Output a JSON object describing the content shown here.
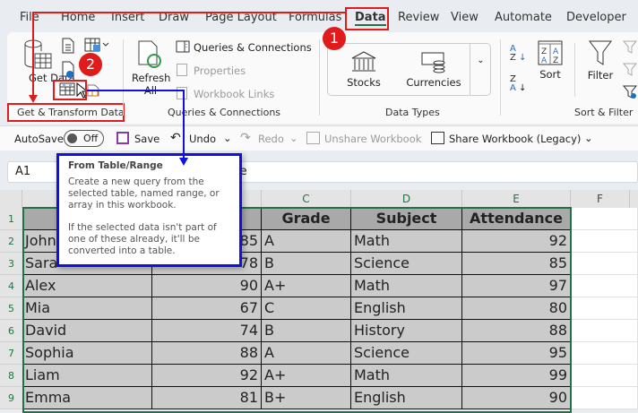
{
  "tabs": [
    "File",
    "Home",
    "Insert",
    "Draw",
    "Page Layout",
    "Formulas",
    "Data",
    "Review",
    "View",
    "Automate",
    "Developer"
  ],
  "active_tab": "Data",
  "ribbon": {
    "get_data": "Get Data",
    "groups": {
      "get_transform": "Get & Transform Data",
      "queries": "Queries & Connections",
      "data_types": "Data Types",
      "sort_filter": "Sort & Filter"
    },
    "refresh_all": "Refresh All",
    "queries_connections": "Queries & Connections",
    "properties": "Properties",
    "workbook_links": "Workbook Links",
    "stocks": "Stocks",
    "currencies": "Currencies",
    "sort": "Sort",
    "filter": "Filter"
  },
  "qat": {
    "autosave": "AutoSave",
    "autosave_state": "Off",
    "save": "Save",
    "undo": "Undo",
    "redo": "Redo",
    "unshare": "Unshare Workbook",
    "share": "Share Workbook (Legacy)"
  },
  "formula_bar": {
    "name_box": "A1",
    "content_visible": "ame"
  },
  "tooltip": {
    "title": "From Table/Range",
    "p1": "Create a new query from the selected table, named range, or array in this workbook.",
    "p2": "If the selected data isn't part of one of these already, it'll be converted into a table."
  },
  "annotations": {
    "step1": "1",
    "step2": "2",
    "color_red": "#e01b1b",
    "color_blue": "#1010e0"
  },
  "sheet": {
    "columns": [
      "C",
      "D",
      "E",
      "F"
    ],
    "rows": [
      "1",
      "2",
      "3",
      "4",
      "5",
      "6",
      "7",
      "8",
      "9"
    ],
    "header": [
      "Grade",
      "Subject",
      "Attendance"
    ],
    "data": [
      [
        "John",
        "85",
        "A",
        "Math",
        "92"
      ],
      [
        "Sara",
        "78",
        "B",
        "Science",
        "85"
      ],
      [
        "Alex",
        "90",
        "A+",
        "Math",
        "97"
      ],
      [
        "Mia",
        "67",
        "C",
        "English",
        "80"
      ],
      [
        "David",
        "74",
        "B",
        "History",
        "88"
      ],
      [
        "Sophia",
        "88",
        "A",
        "Science",
        "95"
      ],
      [
        "Liam",
        "92",
        "A+",
        "Math",
        "99"
      ],
      [
        "Emma",
        "81",
        "B+",
        "English",
        "90"
      ]
    ]
  }
}
